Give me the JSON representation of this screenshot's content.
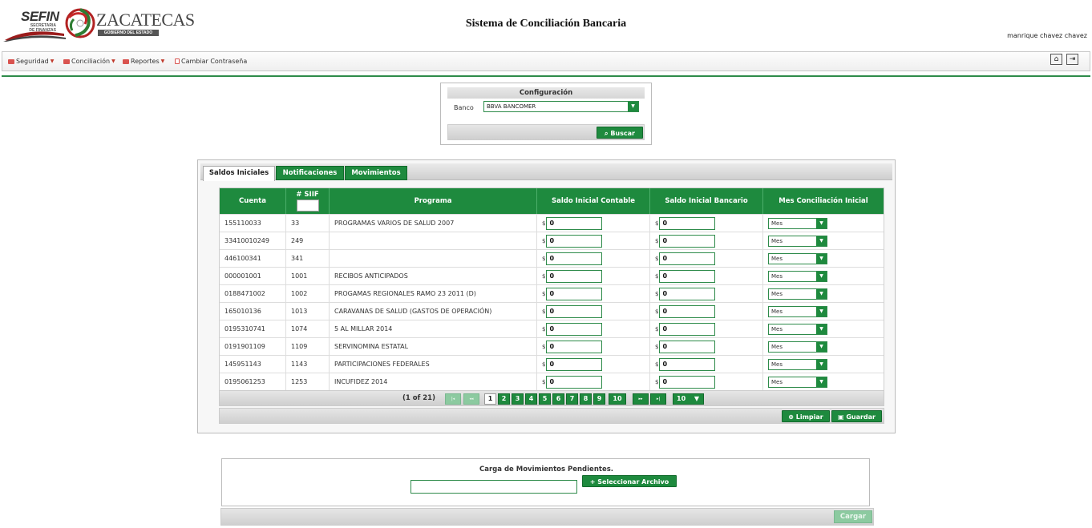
{
  "header": {
    "logo": {
      "sefin": "SEFIN",
      "sefin_sub": "SECRETARIA DE FINANZAS",
      "zacatecas": "ZACATECAS",
      "gobierno": "GOBIERNO DEL ESTADO"
    },
    "app_title": "Sistema de Conciliación Bancaria",
    "user": "manrique chavez chavez"
  },
  "menu": {
    "items": [
      {
        "label": "Seguridad",
        "icon": "folder-icon",
        "has_caret": true
      },
      {
        "label": "Conciliación",
        "icon": "folder-icon",
        "has_caret": true
      },
      {
        "label": "Reportes",
        "icon": "folder-icon",
        "has_caret": true
      },
      {
        "label": "Cambiar Contraseña",
        "icon": "document-icon",
        "has_caret": false
      }
    ],
    "tools": [
      {
        "icon": "home-icon"
      },
      {
        "icon": "logout-icon"
      }
    ]
  },
  "config": {
    "title": "Configuración",
    "banco_label": "Banco",
    "banco_value": "BBVA BANCOMER",
    "search_label": "Buscar"
  },
  "tabs": [
    {
      "label": "Saldos Iniciales",
      "active": true
    },
    {
      "label": "Notificaciones",
      "active": false
    },
    {
      "label": "Movimientos",
      "active": false
    }
  ],
  "table": {
    "columns": [
      "Cuenta",
      "# SIIF",
      "Programa",
      "Saldo Inicial Contable",
      "Saldo Inicial Bancario",
      "Mes Conciliación Inicial"
    ],
    "currency": "$",
    "month_placeholder": "Mes",
    "rows": [
      {
        "cuenta": "155110033",
        "siif": "33",
        "programa": "PROGRAMAS VARIOS DE SALUD 2007",
        "contable": "0",
        "bancario": "0"
      },
      {
        "cuenta": "33410010249",
        "siif": "249",
        "programa": "",
        "contable": "0",
        "bancario": "0"
      },
      {
        "cuenta": "446100341",
        "siif": "341",
        "programa": "",
        "contable": "0",
        "bancario": "0"
      },
      {
        "cuenta": "000001001",
        "siif": "1001",
        "programa": "RECIBOS ANTICIPADOS",
        "contable": "0",
        "bancario": "0"
      },
      {
        "cuenta": "0188471002",
        "siif": "1002",
        "programa": "PROGAMAS REGIONALES RAMO 23 2011 (D)",
        "contable": "0",
        "bancario": "0"
      },
      {
        "cuenta": "165010136",
        "siif": "1013",
        "programa": "CARAVANAS DE SALUD (GASTOS DE OPERACIÓN)",
        "contable": "0",
        "bancario": "0"
      },
      {
        "cuenta": "0195310741",
        "siif": "1074",
        "programa": "5 AL MILLAR 2014",
        "contable": "0",
        "bancario": "0"
      },
      {
        "cuenta": "0191901109",
        "siif": "1109",
        "programa": "SERVINOMINA ESTATAL",
        "contable": "0",
        "bancario": "0"
      },
      {
        "cuenta": "145951143",
        "siif": "1143",
        "programa": "PARTICIPACIONES FEDERALES",
        "contable": "0",
        "bancario": "0"
      },
      {
        "cuenta": "0195061253",
        "siif": "1253",
        "programa": "INCUFIDEZ 2014",
        "contable": "0",
        "bancario": "0"
      }
    ]
  },
  "pager": {
    "info": "(1 of 21)",
    "first": "|◂",
    "prev": "◂◂",
    "pages": [
      "1",
      "2",
      "3",
      "4",
      "5",
      "6",
      "7",
      "8",
      "9",
      "10"
    ],
    "current_page": "1",
    "next": "▸▸",
    "last": "▸|",
    "per_page": "10"
  },
  "actions": {
    "limpiar": "Limpiar",
    "guardar": "Guardar"
  },
  "upload": {
    "title": "Carga de Movimientos Pendientes.",
    "select_label": "Seleccionar Archivo",
    "file_value": "",
    "cargar_label": "Cargar"
  },
  "colors": {
    "accent": "#1e8a3e",
    "accent_disabled": "#8ccaa0"
  }
}
